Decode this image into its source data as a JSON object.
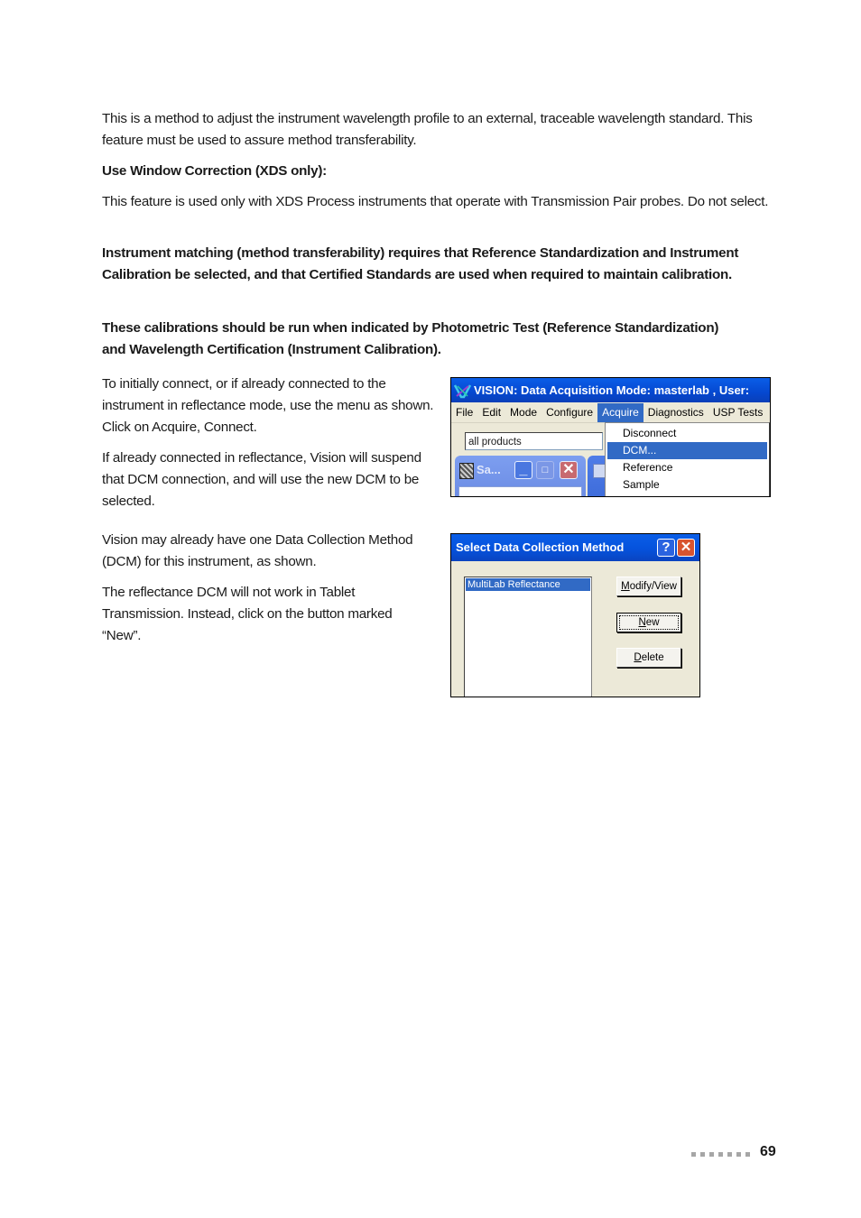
{
  "paragraphs": {
    "intro": "This is a method to adjust the instrument wavelength profile to an external, traceable wavelength standard. This feature must be used to assure method transferability.",
    "window_correction_heading": "Use Window Correction (XDS only):",
    "window_correction_text": "This feature is used only with XDS Process instruments that operate with Transmission Pair probes. Do not select.",
    "matching_note": "Instrument matching (method transferability) requires that Reference Standardization and Instrument Calibration be selected, and that Certified Standards are used when required to maintain calibration.",
    "calibration_note": "These calibrations should be run when indicated by Photometric Test (Reference Standardization) and Wavelength Certification (Instrument Calibration).",
    "connect_text": "To initially connect, or if already connected to the instrument in reflectance mode, use the menu as shown. Click on Acquire, Connect.",
    "suspend_text": "If already connected in reflectance, Vision will suspend that DCM connection, and will use the new DCM to be selected.",
    "existing_dcm_text": "Vision may already have one Data Collection Method (DCM) for this instrument, as shown.",
    "new_button_text": "The reflectance DCM will not work in Tablet Transmission. Instead, click on the button marked “New”."
  },
  "vision_window": {
    "title": "VISION: Data Acquisition Mode: masterlab , User:",
    "menu": [
      "File",
      "Edit",
      "Mode",
      "Configure",
      "Acquire",
      "Diagnostics",
      "USP Tests"
    ],
    "active_menu": "Acquire",
    "product_combo_value": "all products",
    "child_window_title": "Sa...",
    "acquire_dropdown": [
      "Disconnect",
      "DCM...",
      "Reference",
      "Sample"
    ],
    "highlighted_item": "DCM..."
  },
  "dcm_dialog": {
    "title": "Select Data Collection Method",
    "help_glyph": "?",
    "close_glyph": "✕",
    "list_items": [
      "MultiLab Reflectance"
    ],
    "selected_item": "MultiLab Reflectance",
    "buttons": {
      "modify_view": {
        "mnemonic": "M",
        "rest": "odify/View"
      },
      "new": {
        "mnemonic": "N",
        "rest": "ew"
      },
      "delete": {
        "mnemonic": "D",
        "rest": "elete"
      }
    }
  },
  "footer": {
    "page_number": "69"
  },
  "colors": {
    "xp_title_blue": "#0552dc",
    "selection_blue": "#316ac5",
    "dialog_face": "#ece9d8"
  }
}
